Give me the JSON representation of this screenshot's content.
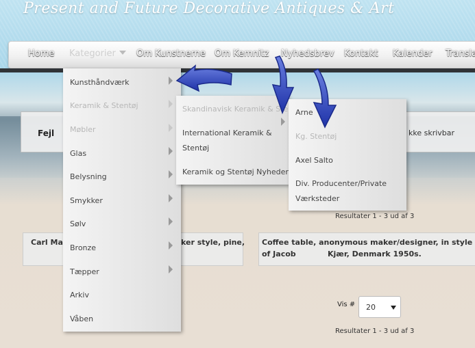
{
  "site": {
    "title": "Present and Future Decorative Antiques & Art"
  },
  "nav": {
    "items": [
      "Home",
      "Kategorier",
      "Om Kunstnerne",
      "Om Kemnitz",
      "Nyhedsbrev",
      "Kontakt",
      "Kalender",
      "Transla"
    ]
  },
  "error": {
    "label": "Fejl",
    "text": "kke skrivbar"
  },
  "menu_level1": {
    "items": [
      {
        "label": "Kunsthåndværk"
      },
      {
        "label": "Keramik & Stentøj"
      },
      {
        "label": "Møbler"
      },
      {
        "label": "Glas"
      },
      {
        "label": "Belysning"
      },
      {
        "label": "Smykker"
      },
      {
        "label": "Sølv"
      },
      {
        "label": "Bronze"
      },
      {
        "label": "Tæpper"
      },
      {
        "label": "Arkiv"
      },
      {
        "label": "Våben"
      }
    ]
  },
  "menu_level2": {
    "items": [
      {
        "label": "Skandinavisk Keramik & Stentøj"
      },
      {
        "label": "International Keramik &"
      },
      {
        "label": "Stentøj"
      },
      {
        "label": "Keramik og Stentøj Nyheder"
      }
    ]
  },
  "menu_level3": {
    "items": [
      {
        "label": "Arne"
      },
      {
        "label": "Kg. Stentøj"
      },
      {
        "label": "Axel Salto"
      },
      {
        "label": "Div. Producenter/Private"
      },
      {
        "label": "Værksteder"
      }
    ]
  },
  "products": {
    "card1_left": "Carl Malm",
    "card1_right": "ker style, pine,",
    "card2_line1": "Coffee table, anonymous maker/designer, in style of Jacob",
    "card2_line2": "Kjær, Denmark 1950s."
  },
  "results": {
    "top": "Resultater 1 - 3 ud af 3",
    "bottom": "Resultater 1 - 3 ud af 3"
  },
  "pager": {
    "label": "Vis #",
    "value": "20"
  },
  "colors": {
    "arrow_fill": "#2a3fb0",
    "nav_bar": "#f0f0f0",
    "dark_bar": "#2f3337"
  }
}
